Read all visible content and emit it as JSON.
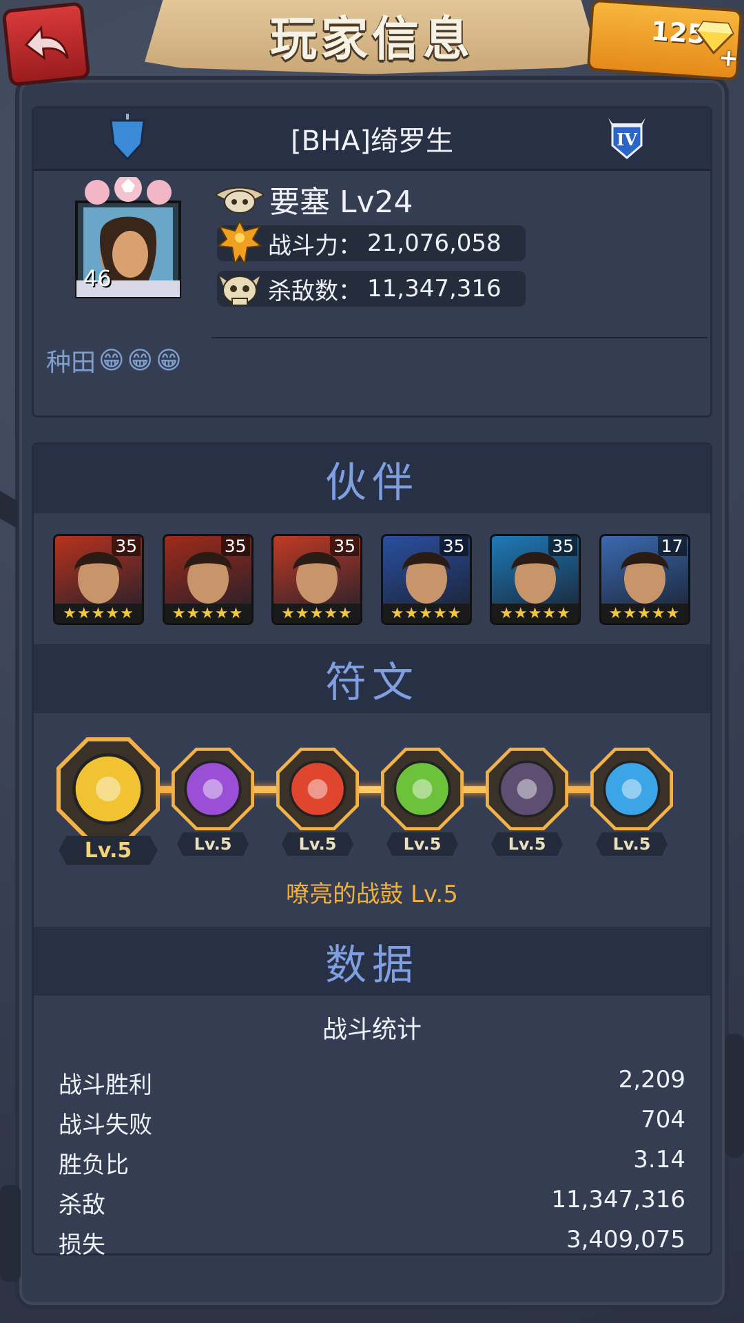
{
  "header": {
    "title": "玩家信息",
    "gems": "125",
    "gem_plus": "+"
  },
  "player": {
    "name": "[BHA]绮罗生",
    "avatar_level": "46",
    "fortress": "要塞 Lv24",
    "power_label": "战斗力：",
    "power_value": "21,076,058",
    "kills_label": "杀敌数：",
    "kills_value": "11,347,316",
    "motto": "种田",
    "motto_emojis": [
      "😁",
      "😁",
      "😁"
    ],
    "tier_badge": "IV"
  },
  "companions": {
    "title": "伙伴",
    "heroes": [
      {
        "level": "35",
        "stars": "★★★★★",
        "color": "#b8321e"
      },
      {
        "level": "35",
        "stars": "★★★★★",
        "color": "#a02a1a"
      },
      {
        "level": "35",
        "stars": "★★★★★",
        "color": "#c23a24"
      },
      {
        "level": "35",
        "stars": "★★★★★",
        "color": "#2a4fa0"
      },
      {
        "level": "35",
        "stars": "★★★★★",
        "color": "#1e7ab8"
      },
      {
        "level": "17",
        "stars": "★★★★★",
        "color": "#3a6ab0"
      }
    ]
  },
  "runes": {
    "title": "符文",
    "items": [
      {
        "level": "Lv.5",
        "color": "#f1c232",
        "icon": "drum-rune-icon"
      },
      {
        "level": "Lv.5",
        "color": "#9a4fd6",
        "icon": "eye-rune-icon"
      },
      {
        "level": "Lv.5",
        "color": "#e0462e",
        "icon": "hammer-rune-icon"
      },
      {
        "level": "Lv.5",
        "color": "#6cc23a",
        "icon": "heart-rune-icon"
      },
      {
        "level": "Lv.5",
        "color": "#5e4f72",
        "icon": "slash-rune-icon"
      },
      {
        "level": "Lv.5",
        "color": "#3ba5e8",
        "icon": "lock-rune-icon"
      }
    ],
    "selected_caption": "嘹亮的战鼓 Lv.5"
  },
  "data": {
    "title": "数据",
    "subtitle": "战斗统计",
    "rows": [
      {
        "label": "战斗胜利",
        "value": "2,209"
      },
      {
        "label": "战斗失败",
        "value": "704"
      },
      {
        "label": "胜负比",
        "value": "3.14"
      },
      {
        "label": "杀敌",
        "value": "11,347,316"
      },
      {
        "label": "损失",
        "value": "3,409,075"
      }
    ]
  }
}
